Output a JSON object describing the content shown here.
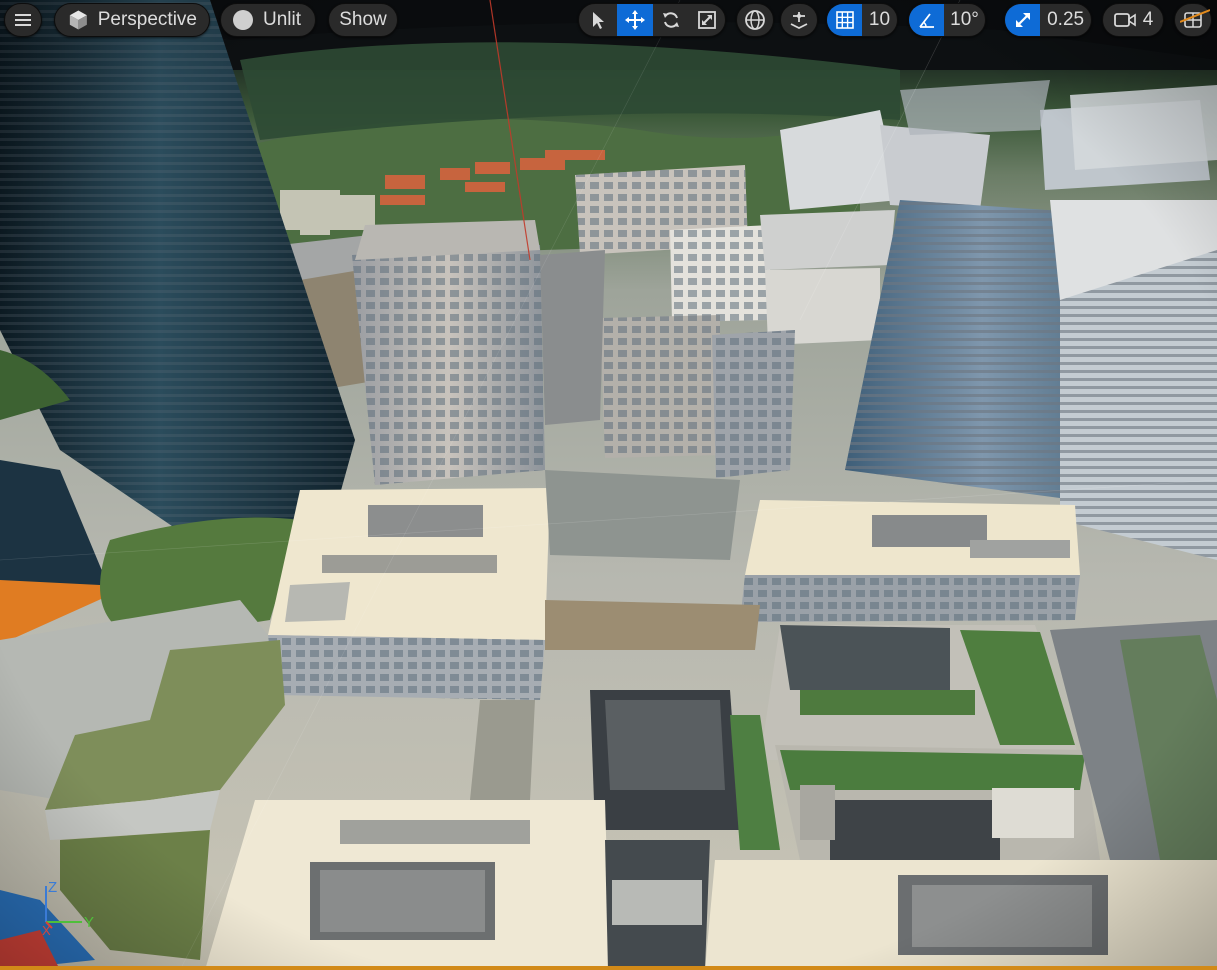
{
  "viewport": {
    "menu_icon": "hamburger-icon",
    "view_mode_label": "Perspective",
    "lighting_label": "Unlit",
    "show_label": "Show",
    "grid_snap_value": "10",
    "rotation_snap_value": "10°",
    "scale_snap_value": "0.25",
    "camera_speed_value": "4",
    "axis_labels": {
      "z": "Z",
      "x": "X",
      "y": "Y"
    },
    "accent_color": "#0e6bd6",
    "selection_color": "#d28a18"
  },
  "transform_tools": [
    {
      "name": "select-tool",
      "icon": "arrow-pointer-icon",
      "active": false
    },
    {
      "name": "translate-tool",
      "icon": "move-arrows-icon",
      "active": true
    },
    {
      "name": "rotate-tool",
      "icon": "rotate-icon",
      "active": false
    },
    {
      "name": "scale-tool",
      "icon": "scale-icon",
      "active": false
    }
  ]
}
